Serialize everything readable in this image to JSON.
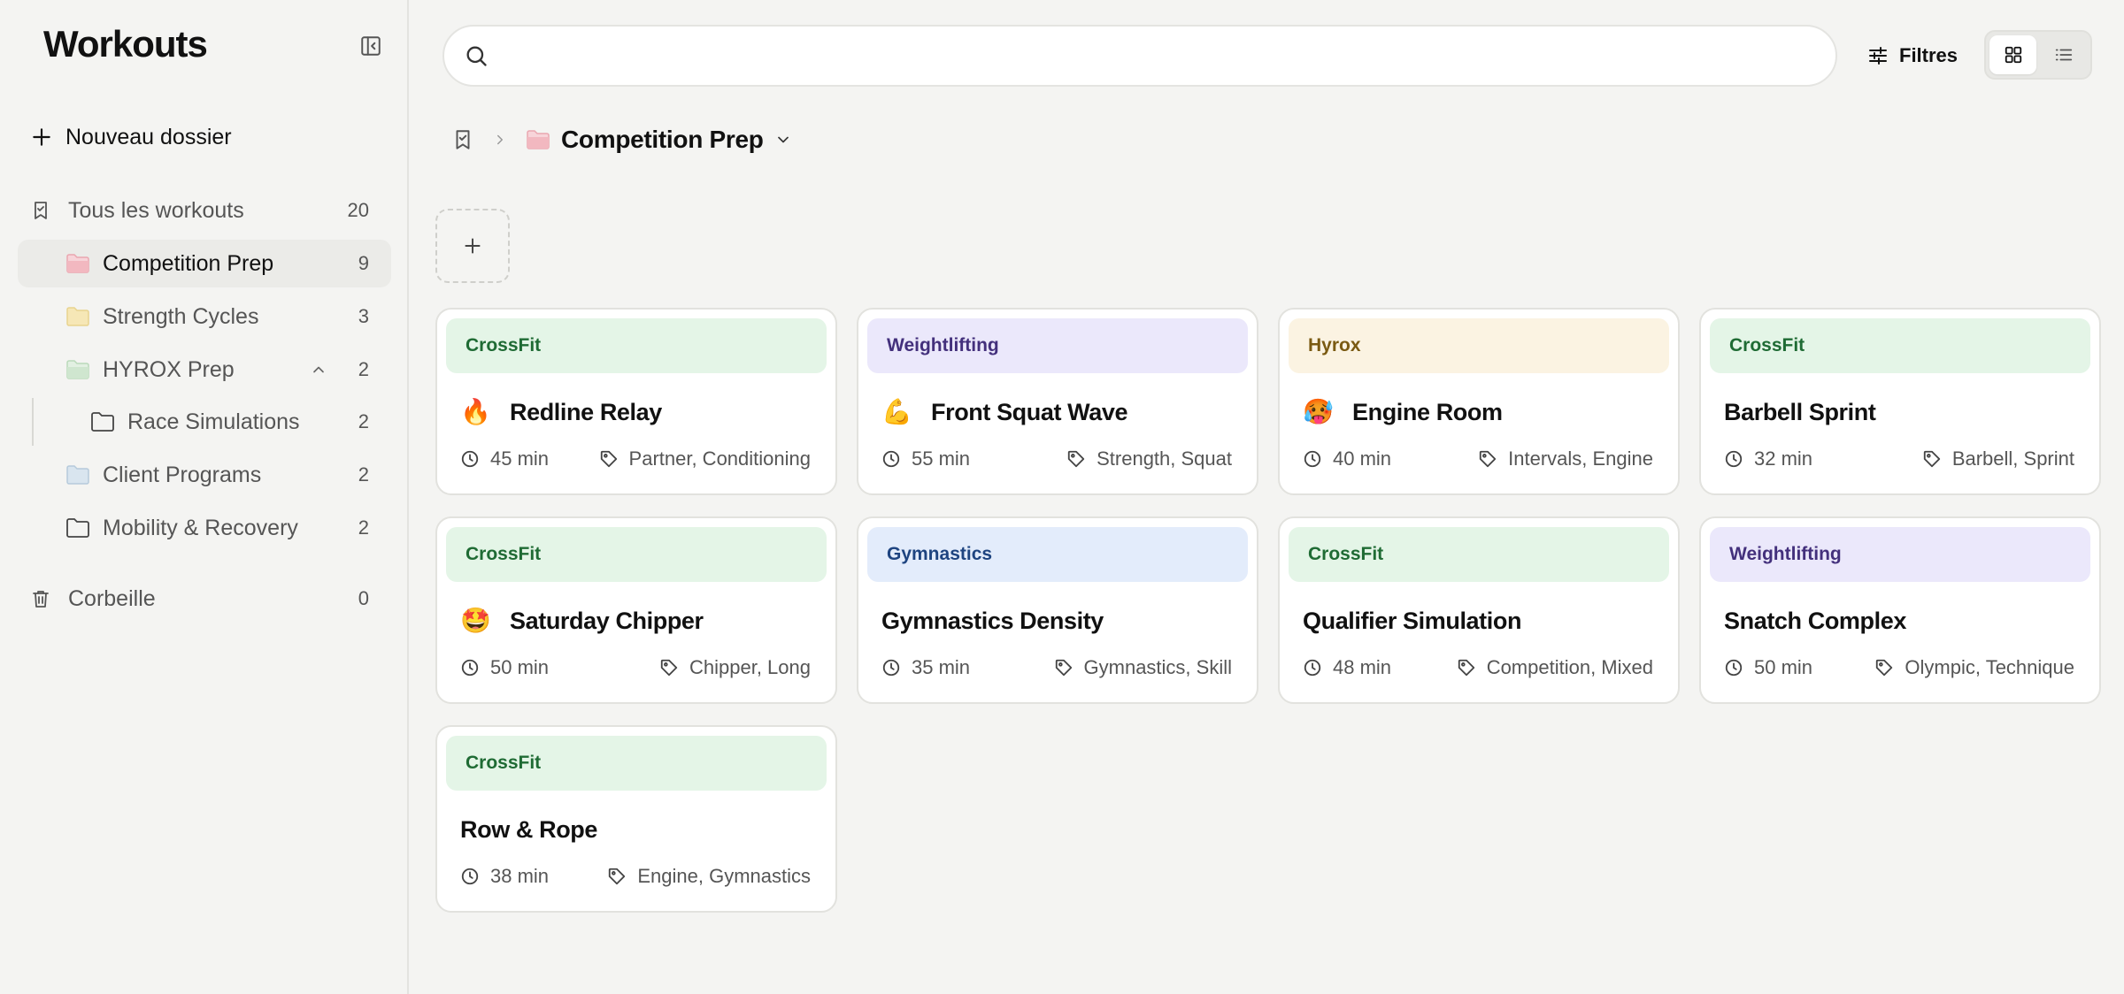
{
  "sidebar": {
    "title": "Workouts",
    "new_folder": "Nouveau dossier",
    "all": {
      "label": "Tous les workouts",
      "count": "20"
    },
    "folders": [
      {
        "label": "Competition Prep",
        "count": "9",
        "color": "#f2b8c0"
      },
      {
        "label": "Strength Cycles",
        "count": "3",
        "color": "#f1dfa4"
      },
      {
        "label": "HYROX Prep",
        "count": "2",
        "color": "#cfe6cf"
      },
      {
        "label": "Race Simulations",
        "count": "2"
      },
      {
        "label": "Client Programs",
        "count": "2",
        "color": "#cfdde9"
      },
      {
        "label": "Mobility & Recovery",
        "count": "2"
      }
    ],
    "trash": {
      "label": "Corbeille",
      "count": "0"
    }
  },
  "search": {
    "placeholder": "",
    "value": ""
  },
  "toolbar": {
    "filters_label": "Filtres",
    "view": "grid"
  },
  "breadcrumb": {
    "current": "Competition Prep"
  },
  "cards": [
    {
      "tag": "CrossFit",
      "emoji": "🔥",
      "title": "Redline Relay",
      "duration": "45 min",
      "tags": "Partner, Conditioning"
    },
    {
      "tag": "Weightlifting",
      "emoji": "💪",
      "title": "Front Squat Wave",
      "duration": "55 min",
      "tags": "Strength, Squat"
    },
    {
      "tag": "Hyrox",
      "emoji": "🥵",
      "title": "Engine Room",
      "duration": "40 min",
      "tags": "Intervals, Engine"
    },
    {
      "tag": "CrossFit",
      "emoji": "",
      "title": "Barbell Sprint",
      "duration": "32 min",
      "tags": "Barbell, Sprint"
    },
    {
      "tag": "CrossFit",
      "emoji": "🤩",
      "title": "Saturday Chipper",
      "duration": "50 min",
      "tags": "Chipper, Long"
    },
    {
      "tag": "Gymnastics",
      "emoji": "",
      "title": "Gymnastics Density",
      "duration": "35 min",
      "tags": "Gymnastics, Skill"
    },
    {
      "tag": "CrossFit",
      "emoji": "",
      "title": "Qualifier Simulation",
      "duration": "48 min",
      "tags": "Competition, Mixed"
    },
    {
      "tag": "Weightlifting",
      "emoji": "",
      "title": "Snatch Complex",
      "duration": "50 min",
      "tags": "Olympic, Technique"
    },
    {
      "tag": "CrossFit",
      "emoji": "",
      "title": "Row & Rope",
      "duration": "38 min",
      "tags": "Engine, Gymnastics"
    }
  ]
}
